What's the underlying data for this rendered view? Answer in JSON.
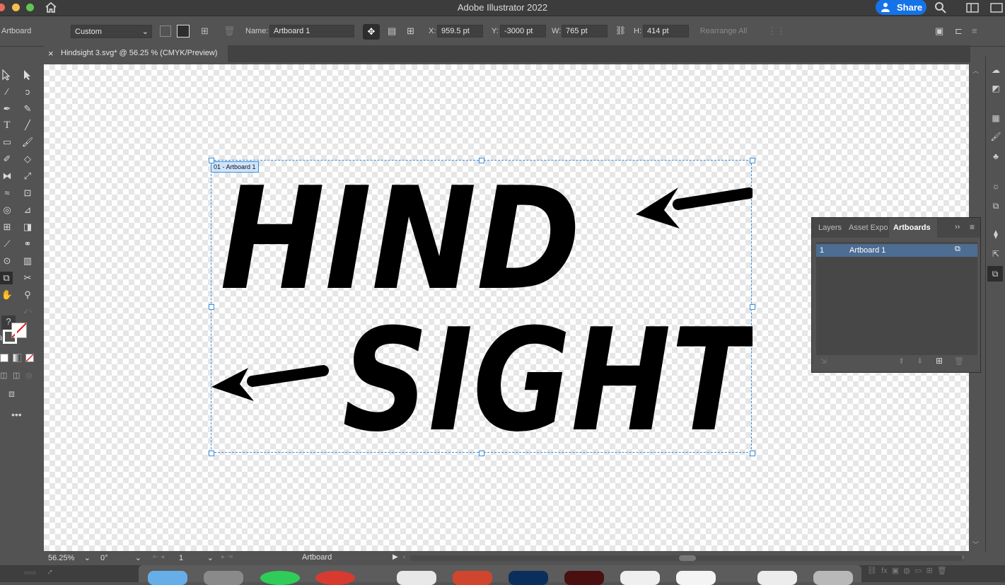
{
  "window": {
    "title": "Adobe Illustrator 2022",
    "share_label": "Share"
  },
  "control": {
    "context_label": "Artboard",
    "preset": "Custom",
    "name_label": "Name:",
    "name_value": "Artboard 1",
    "x_label": "X:",
    "x_value": "959.5 pt",
    "y_label": "Y:",
    "y_value": "-3000 pt",
    "w_label": "W:",
    "w_value": "765 pt",
    "h_label": "H:",
    "h_value": "414 pt",
    "rearrange_label": "Rearrange All"
  },
  "document_tab": {
    "close": "×",
    "title": "Hindsight 3.svg* @ 56.25 % (CMYK/Preview)"
  },
  "artboard": {
    "label": "01 - Artboard 1",
    "line1": "HIND",
    "line2": "SIGHT"
  },
  "panel": {
    "tabs": [
      "Layers",
      "Asset Expo",
      "Artboards"
    ],
    "active_tab": "Artboards",
    "rows": [
      {
        "number": "1",
        "name": "Artboard 1"
      }
    ]
  },
  "status": {
    "zoom": "56.25%",
    "rotation": "0°",
    "artboard_number": "1",
    "tool_label": "Artboard"
  },
  "toolbar": {
    "help_glyph": "?"
  }
}
